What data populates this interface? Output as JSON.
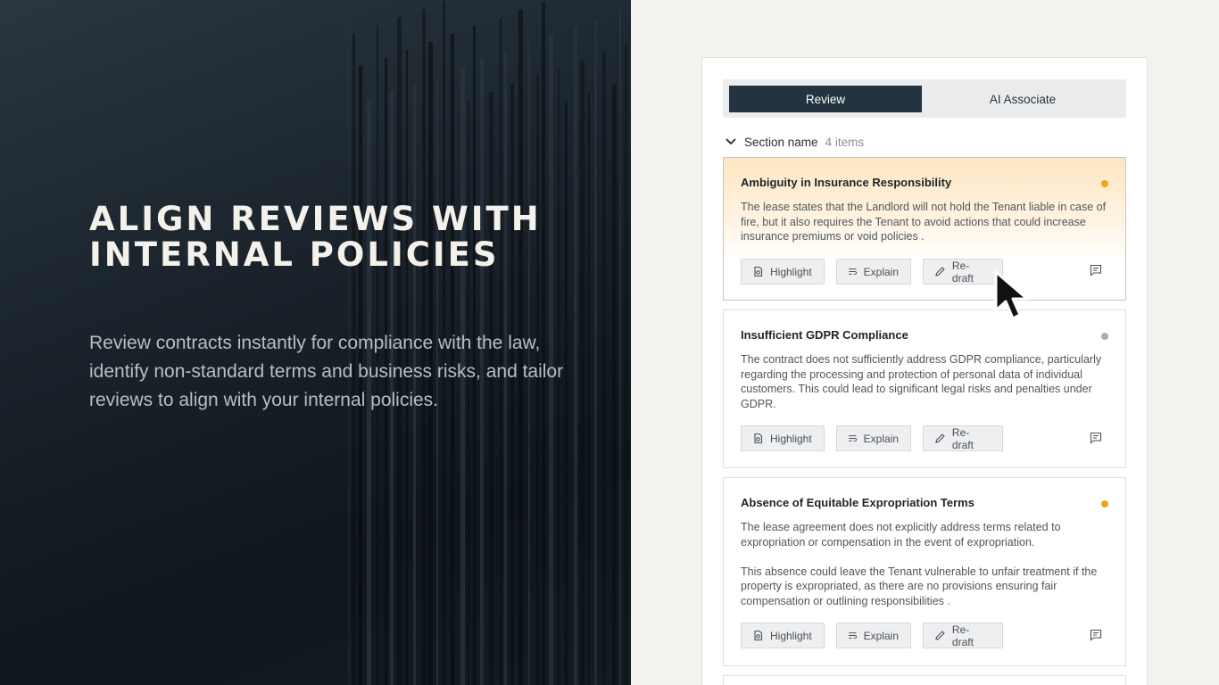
{
  "hero": {
    "title": "ALIGN REVIEWS WITH INTERNAL POLICIES",
    "subtitle": "Review contracts instantly for compliance with the law, identify non-standard terms and business risks, and tailor reviews to align with your internal policies."
  },
  "tabs": [
    {
      "label": "Review",
      "active": true
    },
    {
      "label": "AI Associate",
      "active": false
    }
  ],
  "section": {
    "name": "Section name",
    "count": "4 items",
    "icon": "chevron-down-icon"
  },
  "actions": {
    "highlight": "Highlight",
    "explain": "Explain",
    "redraft": "Re-draft"
  },
  "colors": {
    "accent_dark": "#233440",
    "status_orange": "#f2a417",
    "status_gray": "#a9acae",
    "highlight_bg": "#fde7c4"
  },
  "items": [
    {
      "title": "Ambiguity in Insurance Responsibility",
      "status": "orange",
      "paragraphs": [
        "The lease states that the Landlord will not hold the Tenant liable in case of fire, but it also requires the Tenant to avoid actions that could increase insurance premiums or void policies ."
      ]
    },
    {
      "title": "Insufficient GDPR Compliance",
      "status": "gray",
      "paragraphs": [
        "The contract does not sufficiently address GDPR compliance, particularly regarding the processing and protection of personal data of individual customers. This could lead to significant legal risks and penalties under GDPR."
      ]
    },
    {
      "title": "Absence of Equitable Expropriation Terms",
      "status": "orange",
      "paragraphs": [
        "The lease agreement does not explicitly address terms related to expropriation or compensation in the event of expropriation.",
        "This absence could leave the Tenant vulnerable to unfair treatment if the property is expropriated, as there are no provisions ensuring fair compensation or outlining responsibilities ."
      ]
    }
  ]
}
